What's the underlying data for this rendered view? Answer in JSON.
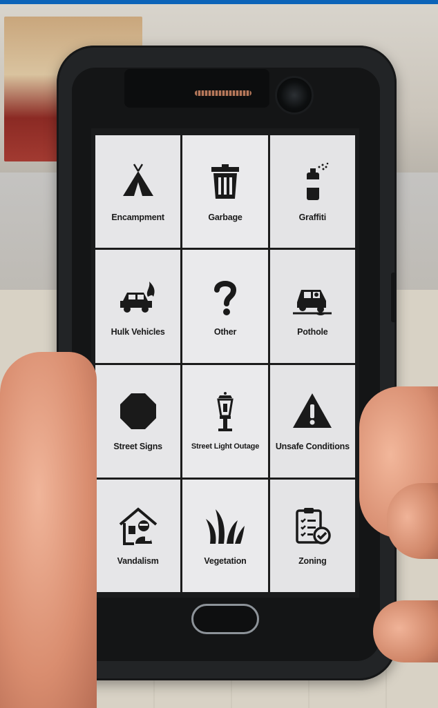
{
  "app": {
    "tiles": [
      {
        "label": "Encampment",
        "icon": "tent-icon"
      },
      {
        "label": "Garbage",
        "icon": "trash-can-icon"
      },
      {
        "label": "Graffiti",
        "icon": "spray-can-icon"
      },
      {
        "label": "Hulk Vehicles",
        "icon": "burning-car-icon"
      },
      {
        "label": "Other",
        "icon": "question-mark-icon"
      },
      {
        "label": "Pothole",
        "icon": "car-in-pothole-icon"
      },
      {
        "label": "Street Signs",
        "icon": "octagon-sign-icon"
      },
      {
        "label": "Street Light Outage",
        "icon": "street-lamp-icon"
      },
      {
        "label": "Unsafe Conditions",
        "icon": "warning-triangle-icon"
      },
      {
        "label": "Vandalism",
        "icon": "house-burglar-icon"
      },
      {
        "label": "Vegetation",
        "icon": "grass-icon"
      },
      {
        "label": "Zoning",
        "icon": "clipboard-check-icon"
      }
    ]
  },
  "colors": {
    "tile_background": "#e8e8ea",
    "grid_lines": "#1b1b1b",
    "icon_color": "#1a1a1a"
  }
}
